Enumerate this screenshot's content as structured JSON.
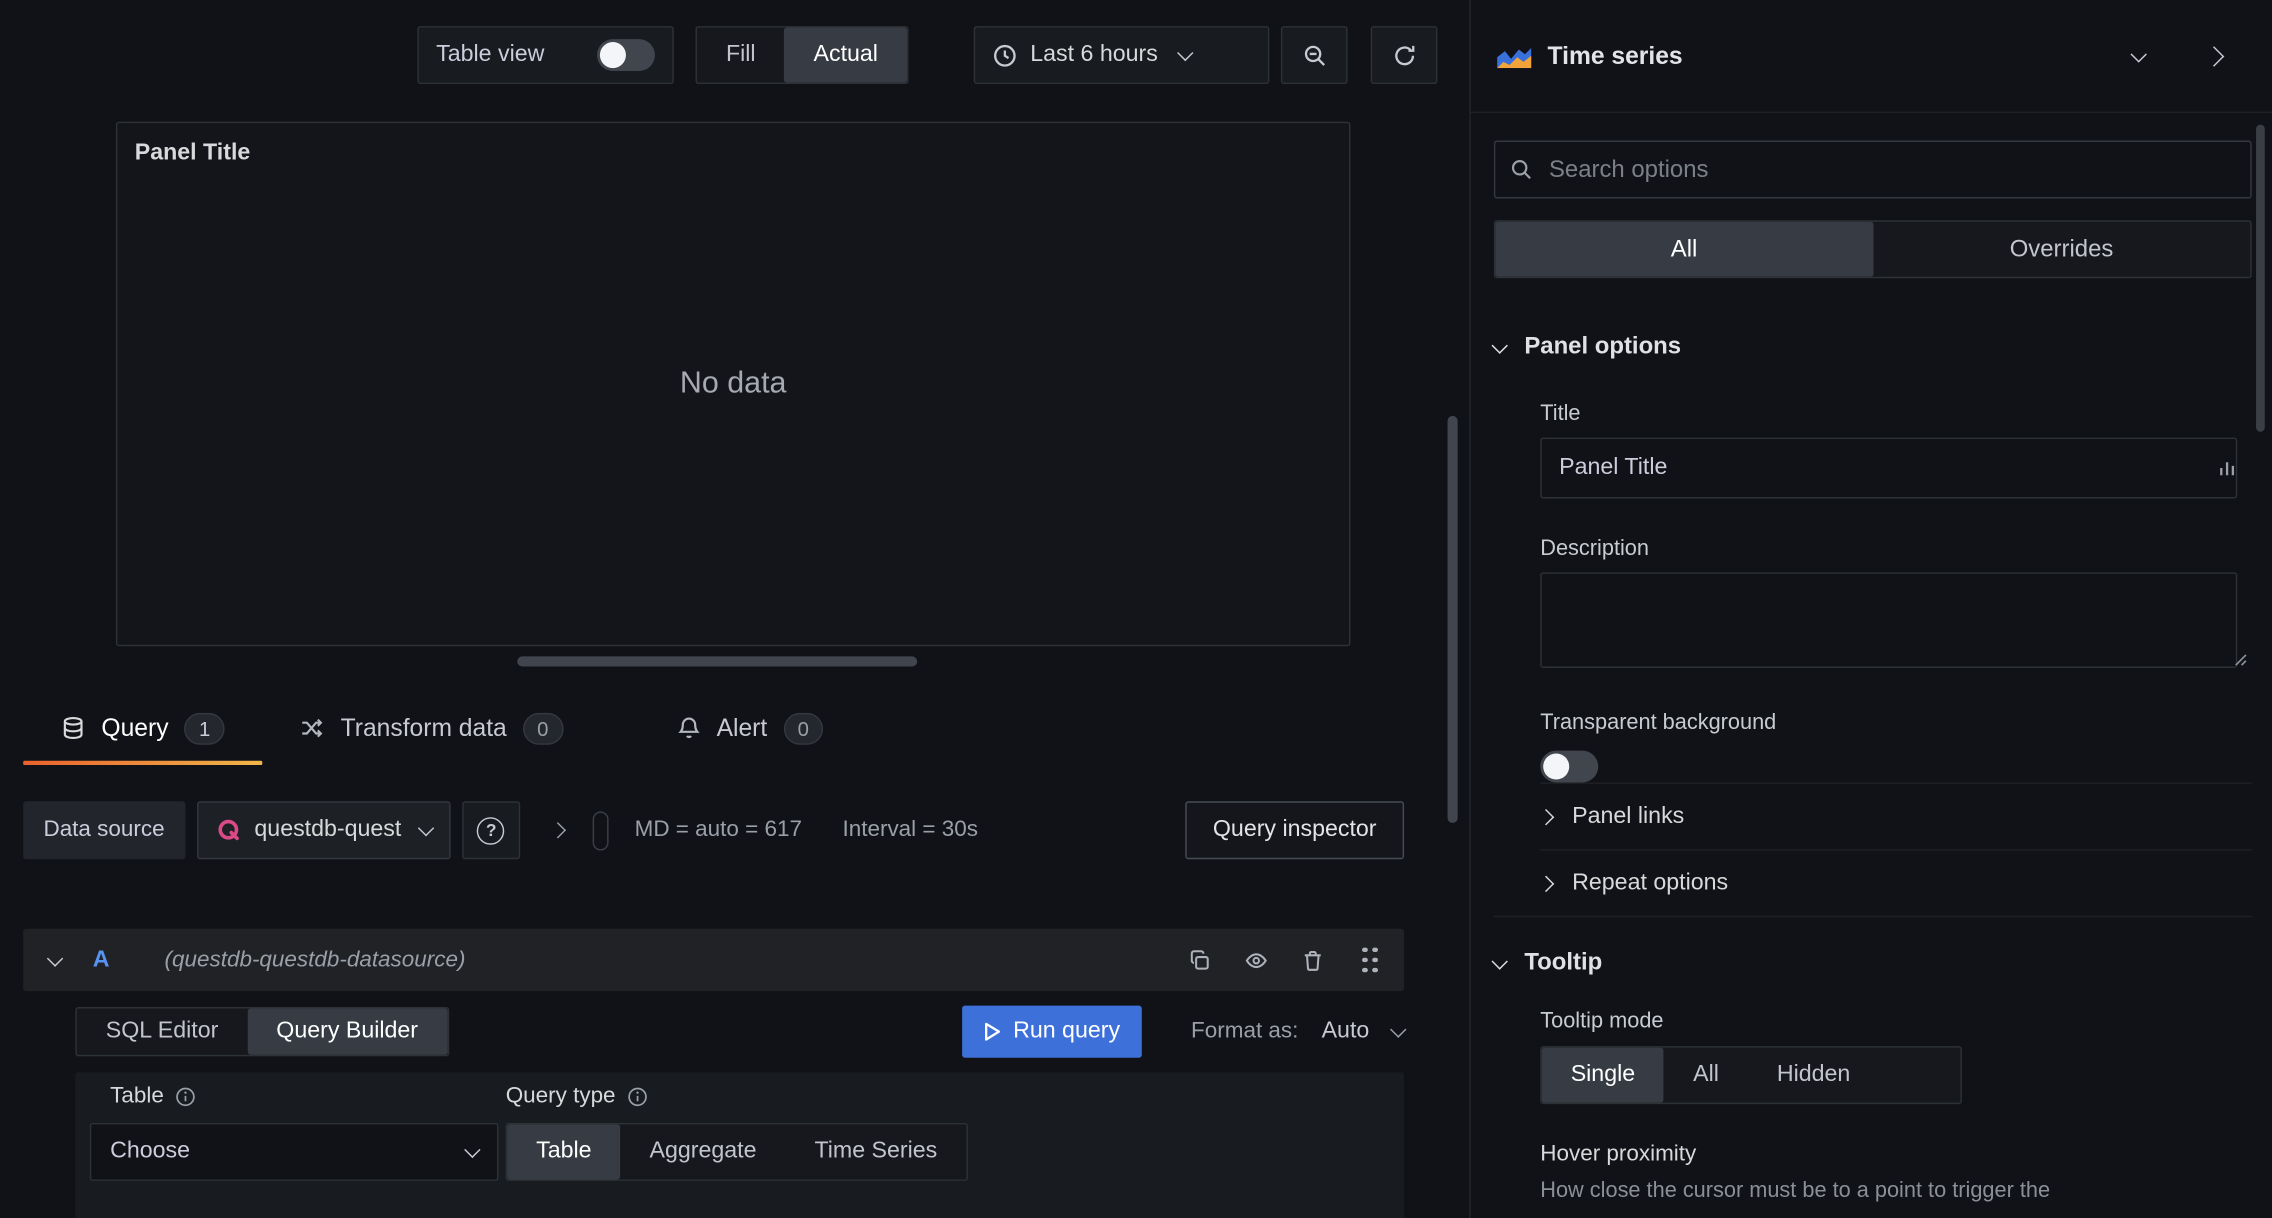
{
  "colors": {
    "background": "#111217",
    "border": "#2c3235",
    "accent_blue": "#3d71d9",
    "ref_id_blue": "#5794f2",
    "active_tab_orange": "#e9622d",
    "questdb_pink": "#d94a86"
  },
  "icons": {
    "clock-icon": "circle clock",
    "zoom-out-icon": "magnifier with minus",
    "refresh-icon": "circular arrow",
    "search-icon": "magnifier",
    "chevron-down-icon": "⌄",
    "chevron-right-icon": "›",
    "database-icon": "cylinder",
    "transform-icon": "shuffle arrows",
    "bell-icon": "bell",
    "copy-icon": "two squares",
    "eye-icon": "eye",
    "trash-icon": "trash can",
    "drag-handle-icon": "six dots",
    "help-icon": "circled ?",
    "info-icon": "circled i",
    "play-icon": "▷",
    "timeseries-icon": "layered area chart"
  },
  "topbar": {
    "table_view": {
      "label": "Table view",
      "state": "off"
    },
    "display_mode": {
      "options": [
        "Fill",
        "Actual"
      ],
      "selected": "Actual"
    },
    "time_range": {
      "label": "Last 6 hours"
    }
  },
  "viz_picker": {
    "label": "Time series"
  },
  "panel": {
    "title": "Panel Title",
    "message": "No data"
  },
  "editor_tabs": {
    "query": {
      "label": "Query",
      "count": "1"
    },
    "transform": {
      "label": "Transform data",
      "count": "0"
    },
    "alert": {
      "label": "Alert",
      "count": "0"
    }
  },
  "datasource_bar": {
    "label": "Data source",
    "selected": "questdb-quest",
    "help": "?",
    "max_data_points": "MD = auto = 617",
    "interval": "Interval = 30s",
    "query_inspector": "Query inspector"
  },
  "query_row": {
    "ref_id": "A",
    "datasource_note": "(questdb-questdb-datasource)",
    "editor_modes": {
      "options": [
        "SQL Editor",
        "Query Builder"
      ],
      "selected": "Query Builder"
    },
    "run_query": "Run query",
    "format_as_label": "Format as:",
    "format_as_value": "Auto",
    "table_field": {
      "label": "Table",
      "value": "Choose"
    },
    "query_type": {
      "label": "Query type",
      "options": [
        "Table",
        "Aggregate",
        "Time Series"
      ],
      "selected": "Table"
    }
  },
  "options_sidebar": {
    "search_placeholder": "Search options",
    "filter_tabs": {
      "options": [
        "All",
        "Overrides"
      ],
      "selected": "All"
    },
    "panel_options": {
      "header": "Panel options",
      "title_label": "Title",
      "title_value": "Panel Title",
      "description_label": "Description",
      "transparent_label": "Transparent background",
      "transparent_state": "off",
      "panel_links_label": "Panel links",
      "repeat_options_label": "Repeat options"
    },
    "tooltip": {
      "header": "Tooltip",
      "mode_label": "Tooltip mode",
      "modes": [
        "Single",
        "All",
        "Hidden"
      ],
      "selected_mode": "Single",
      "hover_label": "Hover proximity",
      "hover_help": "How close the cursor must be to a point to trigger the"
    }
  }
}
